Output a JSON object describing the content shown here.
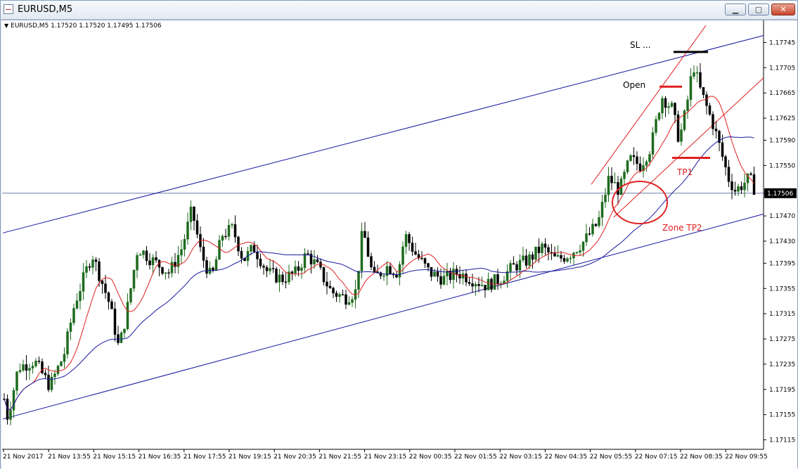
{
  "window": {
    "title": "EURUSD,M5",
    "buttons": {
      "minimize": "▁",
      "maximize": "▢",
      "close": "✕"
    }
  },
  "chart_data": {
    "type": "candlestick",
    "symbol_line": "EURUSD,M5  1.17520 1.17520 1.17495 1.17506",
    "current_price": "1.17506",
    "y_tick_labels": [
      "1.17745",
      "1.17705",
      "1.17665",
      "1.17625",
      "1.17590",
      "1.17550",
      "1.17506",
      "1.17470",
      "1.17430",
      "1.17395",
      "1.17355",
      "1.17315",
      "1.17275",
      "1.17235",
      "1.17195",
      "1.17155",
      "1.17115"
    ],
    "x_tick_labels": [
      "21 Nov 2017",
      "21 Nov 13:55",
      "21 Nov 15:15",
      "21 Nov 16:35",
      "21 Nov 17:55",
      "21 Nov 19:15",
      "21 Nov 20:35",
      "21 Nov 21:55",
      "21 Nov 23:15",
      "22 Nov 00:35",
      "22 Nov 01:55",
      "22 Nov 03:15",
      "22 Nov 04:35",
      "22 Nov 05:55",
      "22 Nov 07:15",
      "22 Nov 08:35",
      "22 Nov 09:55"
    ],
    "annotations": {
      "sl": "SL ...",
      "open": "Open",
      "tp1": "TP1",
      "tp2": "Zone TP2"
    },
    "ylim": [
      1.171,
      1.1778
    ],
    "colors": {
      "bull": "#1e6b1e",
      "bear": "#000000",
      "ma_fast": "#e02020",
      "ma_slow": "#1c1ca0",
      "channel": "#1414a0",
      "annot": "#e02020"
    }
  }
}
